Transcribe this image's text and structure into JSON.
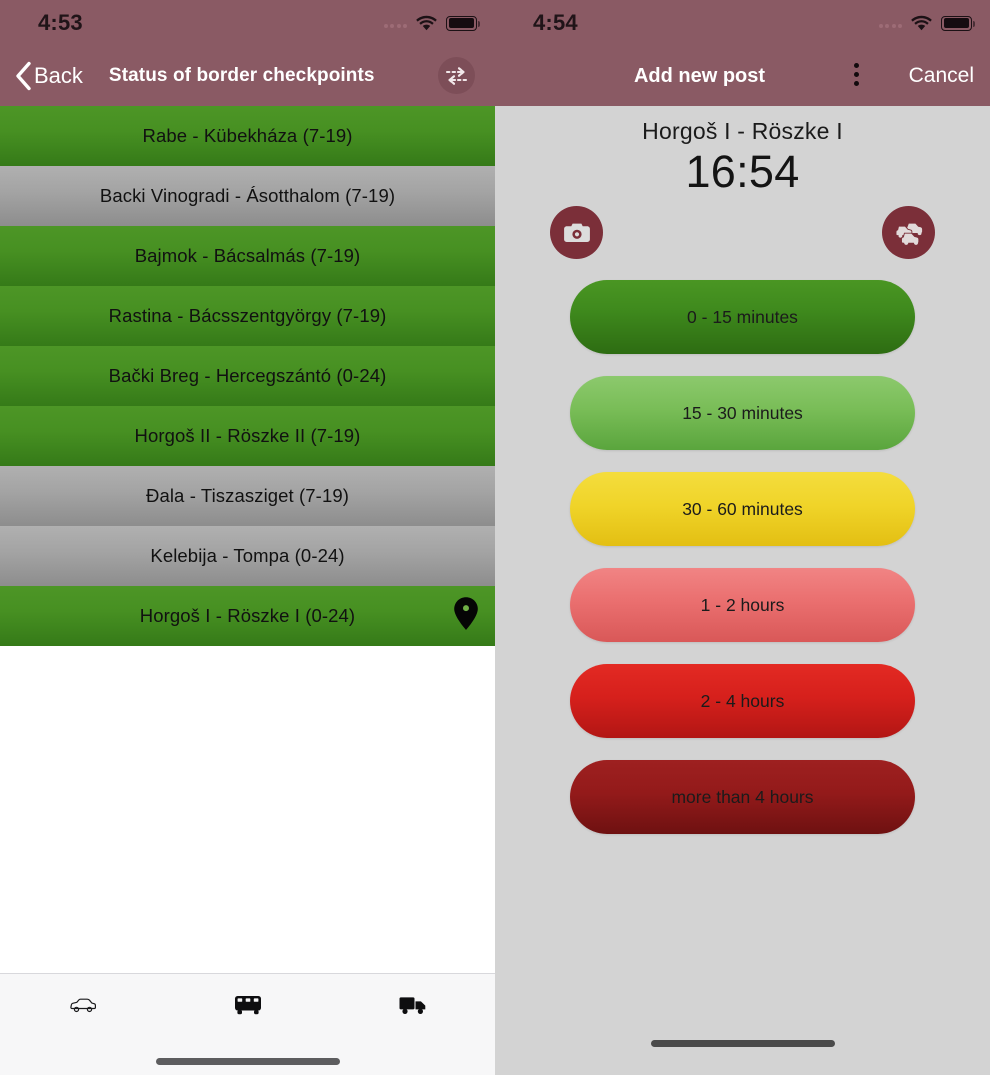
{
  "left": {
    "status": {
      "time": "4:53",
      "signal_icon": "signal-dots-icon",
      "wifi_icon": "wifi-icon",
      "battery_icon": "battery-icon"
    },
    "nav": {
      "back_label": "Back",
      "back_icon": "chevron-left-icon",
      "title": "Status of border checkpoints",
      "swap_icon": "exchange-arrows-icon"
    },
    "checkpoints": [
      {
        "label": "Rabe - Kübekháza (7-19)",
        "status": "green"
      },
      {
        "label": "Backi Vinogradi - Ásotthalom (7-19)",
        "status": "gray"
      },
      {
        "label": "Bajmok - Bácsalmás (7-19)",
        "status": "green"
      },
      {
        "label": "Rastina - Bácsszentgyörgy (7-19)",
        "status": "green"
      },
      {
        "label": "Bački Breg - Hercegszántó (0-24)",
        "status": "green"
      },
      {
        "label": "Horgoš II - Röszke II (7-19)",
        "status": "green"
      },
      {
        "label": "Đala - Tiszasziget (7-19)",
        "status": "gray"
      },
      {
        "label": "Kelebija - Tompa (0-24)",
        "status": "gray"
      },
      {
        "label": "Horgoš I - Röszke I (0-24)",
        "status": "green",
        "pin": "location-pin-icon"
      }
    ],
    "tabbar": {
      "items": [
        {
          "icon": "car-icon",
          "selected": false
        },
        {
          "icon": "bus-icon",
          "selected": true
        },
        {
          "icon": "truck-icon",
          "selected": false
        }
      ]
    },
    "colors": {
      "header": "#8a5a64",
      "green": "#479022",
      "gray": "#a3a3a3"
    }
  },
  "right": {
    "status": {
      "time": "4:54",
      "signal_icon": "signal-dots-icon",
      "wifi_icon": "wifi-icon",
      "battery_icon": "battery-icon"
    },
    "nav": {
      "title": "Add new post",
      "menu_icon": "kebab-menu-icon",
      "cancel_label": "Cancel"
    },
    "post": {
      "crossing_name": "Horgoš I - Röszke I",
      "time": "16:54",
      "camera_icon": "camera-icon",
      "traffic_icon": "traffic-jam-icon"
    },
    "wait_options": [
      {
        "label": "0 - 15 minutes",
        "color": "#3f8a1d",
        "class": "g1"
      },
      {
        "label": "15 - 30 minutes",
        "color": "#79bd57",
        "class": "g2"
      },
      {
        "label": "30  - 60 minutes",
        "color": "#f0d429",
        "class": "y1"
      },
      {
        "label": "1 - 2 hours",
        "color": "#ea6f6f",
        "class": "r1"
      },
      {
        "label": "2 - 4 hours",
        "color": "#d6201c",
        "class": "r2"
      },
      {
        "label": "more than 4 hours",
        "color": "#931a1a",
        "class": "r3"
      }
    ],
    "colors": {
      "header": "#8a5a64",
      "body": "#d3d3d3",
      "accent_circle": "#7b2f39"
    }
  }
}
